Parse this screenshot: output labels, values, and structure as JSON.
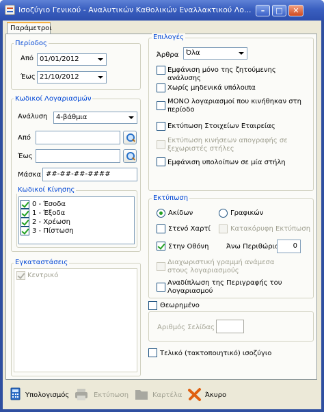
{
  "window": {
    "title": "Ισοζύγιο Γενικού - Αναλυτικών Καθολικών Εναλλακτικού Λο..."
  },
  "tabs": [
    {
      "label": "Παράμετροι"
    }
  ],
  "period": {
    "label": "Περίοδος",
    "from_label": "Από",
    "from_value": "01/01/2012",
    "to_label": "Έως",
    "to_value": "21/10/2012"
  },
  "accounts": {
    "label": "Κωδικοί Λογαριασμών",
    "analysis_label": "Ανάλυση",
    "analysis_value": "4-βάθμια",
    "from_label": "Από",
    "to_label": "Έως",
    "mask_label": "Μάσκα",
    "mask_value": "##-##-##-####",
    "movement_label": "Κωδικοί Κίνησης",
    "movement_codes": [
      {
        "label": "0 - Έσοδα",
        "checked": true
      },
      {
        "label": "1 - Έξοδα",
        "checked": true
      },
      {
        "label": "2 - Χρέωση",
        "checked": true
      },
      {
        "label": "3 - Πίστωση",
        "checked": true
      }
    ]
  },
  "installations": {
    "label": "Εγκαταστάσεις",
    "items": [
      {
        "label": "Κεντρικό",
        "checked": true
      }
    ]
  },
  "options": {
    "label": "Επιλογές",
    "articles_label": "Άρθρα",
    "articles_value": "Όλα",
    "items": [
      {
        "label": "Εμφάνιση μόνο της ζητούμενης ανάλυσης",
        "checked": false,
        "enabled": true
      },
      {
        "label": "Χωρίς μηδενικά υπόλοιπα",
        "checked": false,
        "enabled": true
      },
      {
        "label": "ΜΟΝΟ λογαριασμοί που κινήθηκαν στη περίοδο",
        "checked": false,
        "enabled": true
      },
      {
        "label": "Εκτύπωση Στοιχείων Εταιρείας",
        "checked": false,
        "enabled": true
      },
      {
        "label": "Εκτύπωση κινήσεων απογραφής σε ξεχωριστές στήλες",
        "checked": false,
        "enabled": false
      },
      {
        "label": "Εμφάνιση υπολοίπων σε μία στήλη",
        "checked": false,
        "enabled": true
      }
    ]
  },
  "printing": {
    "label": "Εκτύπωση",
    "radio_plain": "Ακίδων",
    "radio_graphic": "Γραφικών",
    "narrow_paper": "Στενό Χαρτί",
    "vertical_print": "Κατακόρυφη Εκτύπωση",
    "on_screen": "Στην Οθόνη",
    "top_margin_label": "Άνω Περιθώριο",
    "top_margin_value": "0",
    "separator_line": "Διαχωριστική γραμμή ανάμεσα στους λογαριασμούς",
    "fold_description": "Αναδίπλωση της Περιγραφής του Λογαριασμού"
  },
  "certified": {
    "label": "Θεωρημένο",
    "page_number_label": "Αριθμός Σελίδας",
    "page_number_value": ""
  },
  "final_balance": {
    "label": "Τελικό (τακτοποιητικό) ισοζύγιο"
  },
  "buttons": {
    "calculate": "Υπολογισμός",
    "print": "Εκτύπωση",
    "card": "Καρτέλα",
    "cancel": "Άκυρο"
  }
}
